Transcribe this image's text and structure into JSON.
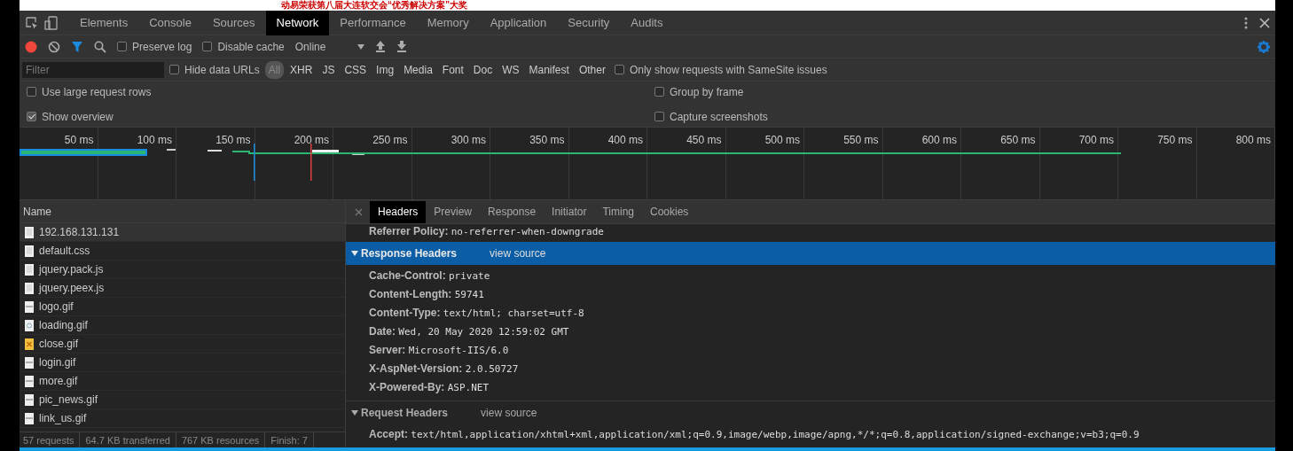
{
  "page_behind": {
    "headline": "动易荣获第八届大连软交会“优秀解决方案”大奖"
  },
  "page_load": {
    "level": 1
  },
  "tabs": [
    {
      "label": "Elements",
      "selected": false
    },
    {
      "label": "Console",
      "selected": false
    },
    {
      "label": "Sources",
      "selected": false
    },
    {
      "label": "Network",
      "selected": true
    },
    {
      "label": "Performance",
      "selected": false
    },
    {
      "label": "Memory",
      "selected": false
    },
    {
      "label": "Application",
      "selected": false
    },
    {
      "label": "Security",
      "selected": false
    },
    {
      "label": "Audits",
      "selected": false
    }
  ],
  "toolbar": {
    "recording": true,
    "checks": [
      {
        "label": "Preserve log",
        "checked": false
      },
      {
        "label": "Disable cache",
        "checked": false
      }
    ],
    "throttle": "Online"
  },
  "filter": {
    "placeholder": "Filter",
    "hide_data_urls": {
      "label": "Hide data URLs",
      "checked": false
    },
    "types": [
      {
        "label": "All",
        "selected": true
      },
      {
        "label": "XHR",
        "selected": false
      },
      {
        "label": "JS",
        "selected": false
      },
      {
        "label": "CSS",
        "selected": false
      },
      {
        "label": "Img",
        "selected": false
      },
      {
        "label": "Media",
        "selected": false
      },
      {
        "label": "Font",
        "selected": false
      },
      {
        "label": "Doc",
        "selected": false
      },
      {
        "label": "WS",
        "selected": false
      },
      {
        "label": "Manifest",
        "selected": false
      },
      {
        "label": "Other",
        "selected": false
      }
    ],
    "samesite": {
      "label": "Only show requests with SameSite issues",
      "checked": false
    }
  },
  "options": [
    {
      "label": "Use large request rows",
      "checked": false
    },
    {
      "label": "Group by frame",
      "checked": false
    },
    {
      "label": "Show overview",
      "checked": true
    },
    {
      "label": "Capture screenshots",
      "checked": false
    }
  ],
  "timeline": {
    "ticks": [
      "50 ms",
      "100 ms",
      "150 ms",
      "200 ms",
      "250 ms",
      "300 ms",
      "350 ms",
      "400 ms",
      "450 ms",
      "500 ms",
      "550 ms",
      "600 ms",
      "650 ms",
      "700 ms",
      "750 ms",
      "800 ms"
    ]
  },
  "requests": {
    "column": "Name",
    "rows": [
      {
        "name": "192.168.131.131",
        "kind": "doc",
        "selected": true
      },
      {
        "name": "default.css",
        "kind": "doc",
        "selected": false
      },
      {
        "name": "jquery.pack.js",
        "kind": "doc",
        "selected": false
      },
      {
        "name": "jquery.peex.js",
        "kind": "doc",
        "selected": false
      },
      {
        "name": "logo.gif",
        "kind": "image",
        "selected": false
      },
      {
        "name": "loading.gif",
        "kind": "spinner",
        "selected": false
      },
      {
        "name": "close.gif",
        "kind": "close",
        "selected": false
      },
      {
        "name": "login.gif",
        "kind": "image",
        "selected": false
      },
      {
        "name": "more.gif",
        "kind": "image",
        "selected": false
      },
      {
        "name": "pic_news.gif",
        "kind": "image",
        "selected": false
      },
      {
        "name": "link_us.gif",
        "kind": "image",
        "selected": false
      }
    ]
  },
  "status": [
    "57 requests",
    "64.7 KB transferred",
    "767 KB resources",
    "Finish: 7"
  ],
  "detail": {
    "tabs": [
      {
        "label": "Headers",
        "selected": true
      },
      {
        "label": "Preview",
        "selected": false
      },
      {
        "label": "Response",
        "selected": false
      },
      {
        "label": "Initiator",
        "selected": false
      },
      {
        "label": "Timing",
        "selected": false
      },
      {
        "label": "Cookies",
        "selected": false
      }
    ],
    "top_header": {
      "key": "Referrer Policy:",
      "value": "no-referrer-when-downgrade"
    },
    "sections": [
      {
        "title": "Response Headers",
        "link": "view source",
        "expanded": true,
        "highlighted": true,
        "headers": [
          {
            "key": "Cache-Control:",
            "value": "private"
          },
          {
            "key": "Content-Length:",
            "value": "59741"
          },
          {
            "key": "Content-Type:",
            "value": "text/html; charset=utf-8"
          },
          {
            "key": "Date:",
            "value": "Wed, 20 May 2020 12:59:02 GMT"
          },
          {
            "key": "Server:",
            "value": "Microsoft-IIS/6.0"
          },
          {
            "key": "X-AspNet-Version:",
            "value": "2.0.50727"
          },
          {
            "key": "X-Powered-By:",
            "value": "ASP.NET"
          }
        ]
      },
      {
        "title": "Request Headers",
        "link": "view source",
        "expanded": true,
        "highlighted": false,
        "headers": [
          {
            "key": "Accept:",
            "value": "text/html,application/xhtml+xml,application/xml;q=0.9,image/webp,image/apng,*/*;q=0.8,application/signed-exchange;v=b3;q=0.9"
          }
        ]
      }
    ]
  }
}
